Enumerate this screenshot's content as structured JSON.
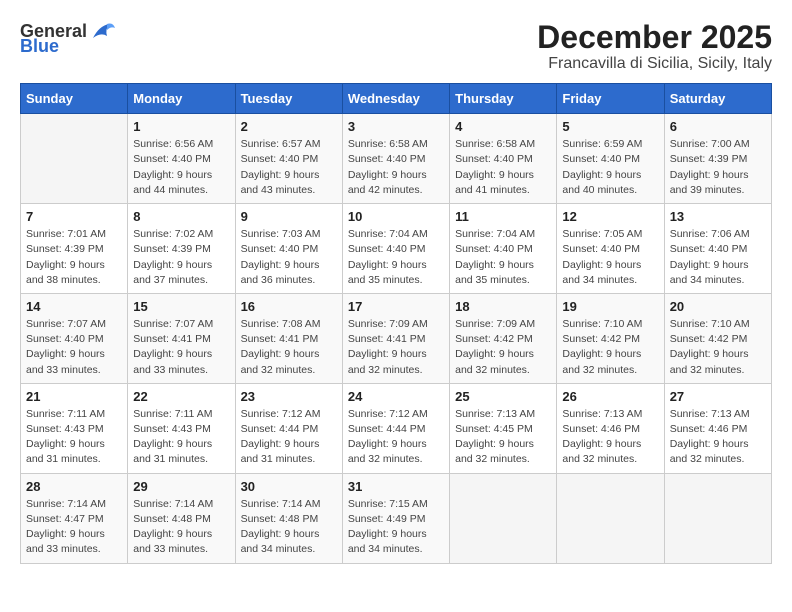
{
  "logo": {
    "general": "General",
    "blue": "Blue"
  },
  "title": "December 2025",
  "subtitle": "Francavilla di Sicilia, Sicily, Italy",
  "days_of_week": [
    "Sunday",
    "Monday",
    "Tuesday",
    "Wednesday",
    "Thursday",
    "Friday",
    "Saturday"
  ],
  "weeks": [
    [
      {
        "day": "",
        "info": ""
      },
      {
        "day": "1",
        "info": "Sunrise: 6:56 AM\nSunset: 4:40 PM\nDaylight: 9 hours\nand 44 minutes."
      },
      {
        "day": "2",
        "info": "Sunrise: 6:57 AM\nSunset: 4:40 PM\nDaylight: 9 hours\nand 43 minutes."
      },
      {
        "day": "3",
        "info": "Sunrise: 6:58 AM\nSunset: 4:40 PM\nDaylight: 9 hours\nand 42 minutes."
      },
      {
        "day": "4",
        "info": "Sunrise: 6:58 AM\nSunset: 4:40 PM\nDaylight: 9 hours\nand 41 minutes."
      },
      {
        "day": "5",
        "info": "Sunrise: 6:59 AM\nSunset: 4:40 PM\nDaylight: 9 hours\nand 40 minutes."
      },
      {
        "day": "6",
        "info": "Sunrise: 7:00 AM\nSunset: 4:39 PM\nDaylight: 9 hours\nand 39 minutes."
      }
    ],
    [
      {
        "day": "7",
        "info": "Sunrise: 7:01 AM\nSunset: 4:39 PM\nDaylight: 9 hours\nand 38 minutes."
      },
      {
        "day": "8",
        "info": "Sunrise: 7:02 AM\nSunset: 4:39 PM\nDaylight: 9 hours\nand 37 minutes."
      },
      {
        "day": "9",
        "info": "Sunrise: 7:03 AM\nSunset: 4:40 PM\nDaylight: 9 hours\nand 36 minutes."
      },
      {
        "day": "10",
        "info": "Sunrise: 7:04 AM\nSunset: 4:40 PM\nDaylight: 9 hours\nand 35 minutes."
      },
      {
        "day": "11",
        "info": "Sunrise: 7:04 AM\nSunset: 4:40 PM\nDaylight: 9 hours\nand 35 minutes."
      },
      {
        "day": "12",
        "info": "Sunrise: 7:05 AM\nSunset: 4:40 PM\nDaylight: 9 hours\nand 34 minutes."
      },
      {
        "day": "13",
        "info": "Sunrise: 7:06 AM\nSunset: 4:40 PM\nDaylight: 9 hours\nand 34 minutes."
      }
    ],
    [
      {
        "day": "14",
        "info": "Sunrise: 7:07 AM\nSunset: 4:40 PM\nDaylight: 9 hours\nand 33 minutes."
      },
      {
        "day": "15",
        "info": "Sunrise: 7:07 AM\nSunset: 4:41 PM\nDaylight: 9 hours\nand 33 minutes."
      },
      {
        "day": "16",
        "info": "Sunrise: 7:08 AM\nSunset: 4:41 PM\nDaylight: 9 hours\nand 32 minutes."
      },
      {
        "day": "17",
        "info": "Sunrise: 7:09 AM\nSunset: 4:41 PM\nDaylight: 9 hours\nand 32 minutes."
      },
      {
        "day": "18",
        "info": "Sunrise: 7:09 AM\nSunset: 4:42 PM\nDaylight: 9 hours\nand 32 minutes."
      },
      {
        "day": "19",
        "info": "Sunrise: 7:10 AM\nSunset: 4:42 PM\nDaylight: 9 hours\nand 32 minutes."
      },
      {
        "day": "20",
        "info": "Sunrise: 7:10 AM\nSunset: 4:42 PM\nDaylight: 9 hours\nand 32 minutes."
      }
    ],
    [
      {
        "day": "21",
        "info": "Sunrise: 7:11 AM\nSunset: 4:43 PM\nDaylight: 9 hours\nand 31 minutes."
      },
      {
        "day": "22",
        "info": "Sunrise: 7:11 AM\nSunset: 4:43 PM\nDaylight: 9 hours\nand 31 minutes."
      },
      {
        "day": "23",
        "info": "Sunrise: 7:12 AM\nSunset: 4:44 PM\nDaylight: 9 hours\nand 31 minutes."
      },
      {
        "day": "24",
        "info": "Sunrise: 7:12 AM\nSunset: 4:44 PM\nDaylight: 9 hours\nand 32 minutes."
      },
      {
        "day": "25",
        "info": "Sunrise: 7:13 AM\nSunset: 4:45 PM\nDaylight: 9 hours\nand 32 minutes."
      },
      {
        "day": "26",
        "info": "Sunrise: 7:13 AM\nSunset: 4:46 PM\nDaylight: 9 hours\nand 32 minutes."
      },
      {
        "day": "27",
        "info": "Sunrise: 7:13 AM\nSunset: 4:46 PM\nDaylight: 9 hours\nand 32 minutes."
      }
    ],
    [
      {
        "day": "28",
        "info": "Sunrise: 7:14 AM\nSunset: 4:47 PM\nDaylight: 9 hours\nand 33 minutes."
      },
      {
        "day": "29",
        "info": "Sunrise: 7:14 AM\nSunset: 4:48 PM\nDaylight: 9 hours\nand 33 minutes."
      },
      {
        "day": "30",
        "info": "Sunrise: 7:14 AM\nSunset: 4:48 PM\nDaylight: 9 hours\nand 34 minutes."
      },
      {
        "day": "31",
        "info": "Sunrise: 7:15 AM\nSunset: 4:49 PM\nDaylight: 9 hours\nand 34 minutes."
      },
      {
        "day": "",
        "info": ""
      },
      {
        "day": "",
        "info": ""
      },
      {
        "day": "",
        "info": ""
      }
    ]
  ]
}
